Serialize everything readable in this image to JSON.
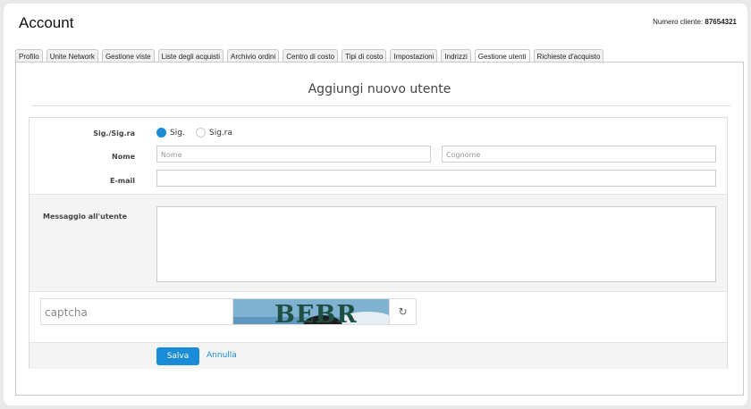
{
  "page": {
    "title": "Account",
    "customer_label": "Numero cliente:",
    "customer_number": "87654321"
  },
  "tabs": [
    {
      "label": "Profilo"
    },
    {
      "label": "Unite Network"
    },
    {
      "label": "Gestione viste"
    },
    {
      "label": "Liste degli acquisti"
    },
    {
      "label": "Archivio ordini"
    },
    {
      "label": "Centro di costo"
    },
    {
      "label": "Tipi di costo"
    },
    {
      "label": "Impostazioni"
    },
    {
      "label": "Indrizzi"
    },
    {
      "label": "Gestione utenti"
    },
    {
      "label": "Richieste d'acquisto"
    }
  ],
  "active_tab": "Gestione utenti",
  "form": {
    "heading": "Aggiungi nuovo utente",
    "salutation_label": "Sig./Sig.ra",
    "salutation_options": [
      "Sig.",
      "Sig.ra"
    ],
    "salutation_selected": "Sig.",
    "name_label": "Nome",
    "first_name_placeholder": "Nome",
    "last_name_placeholder": "Cognome",
    "email_label": "E-mail",
    "email_value": "",
    "message_label": "Messaggio all'utente",
    "message_value": "",
    "captcha_placeholder": "captcha",
    "captcha_text": "BEBR",
    "save_label": "Salva",
    "cancel_label": "Annulla"
  },
  "colors": {
    "accent": "#1a8bd6",
    "section_bg": "#f4f4f4",
    "border": "#c9c9c9"
  },
  "icons": {
    "refresh": "refresh-icon"
  }
}
